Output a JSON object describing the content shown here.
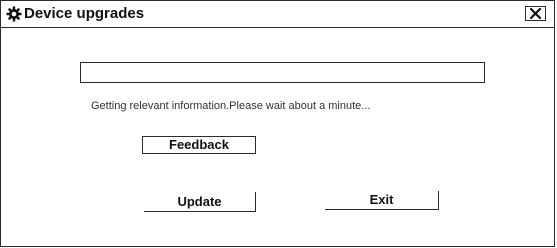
{
  "window": {
    "title": "Device upgrades",
    "title_icon": "gear-icon",
    "close_icon": "close-icon"
  },
  "progress": {
    "value_percent": 0,
    "fill_color": "#4a90d9"
  },
  "status": {
    "message": "Getting relevant information.Please wait about a minute..."
  },
  "buttons": {
    "feedback_label": "Feedback",
    "update_label": "Update",
    "exit_label": "Exit"
  }
}
